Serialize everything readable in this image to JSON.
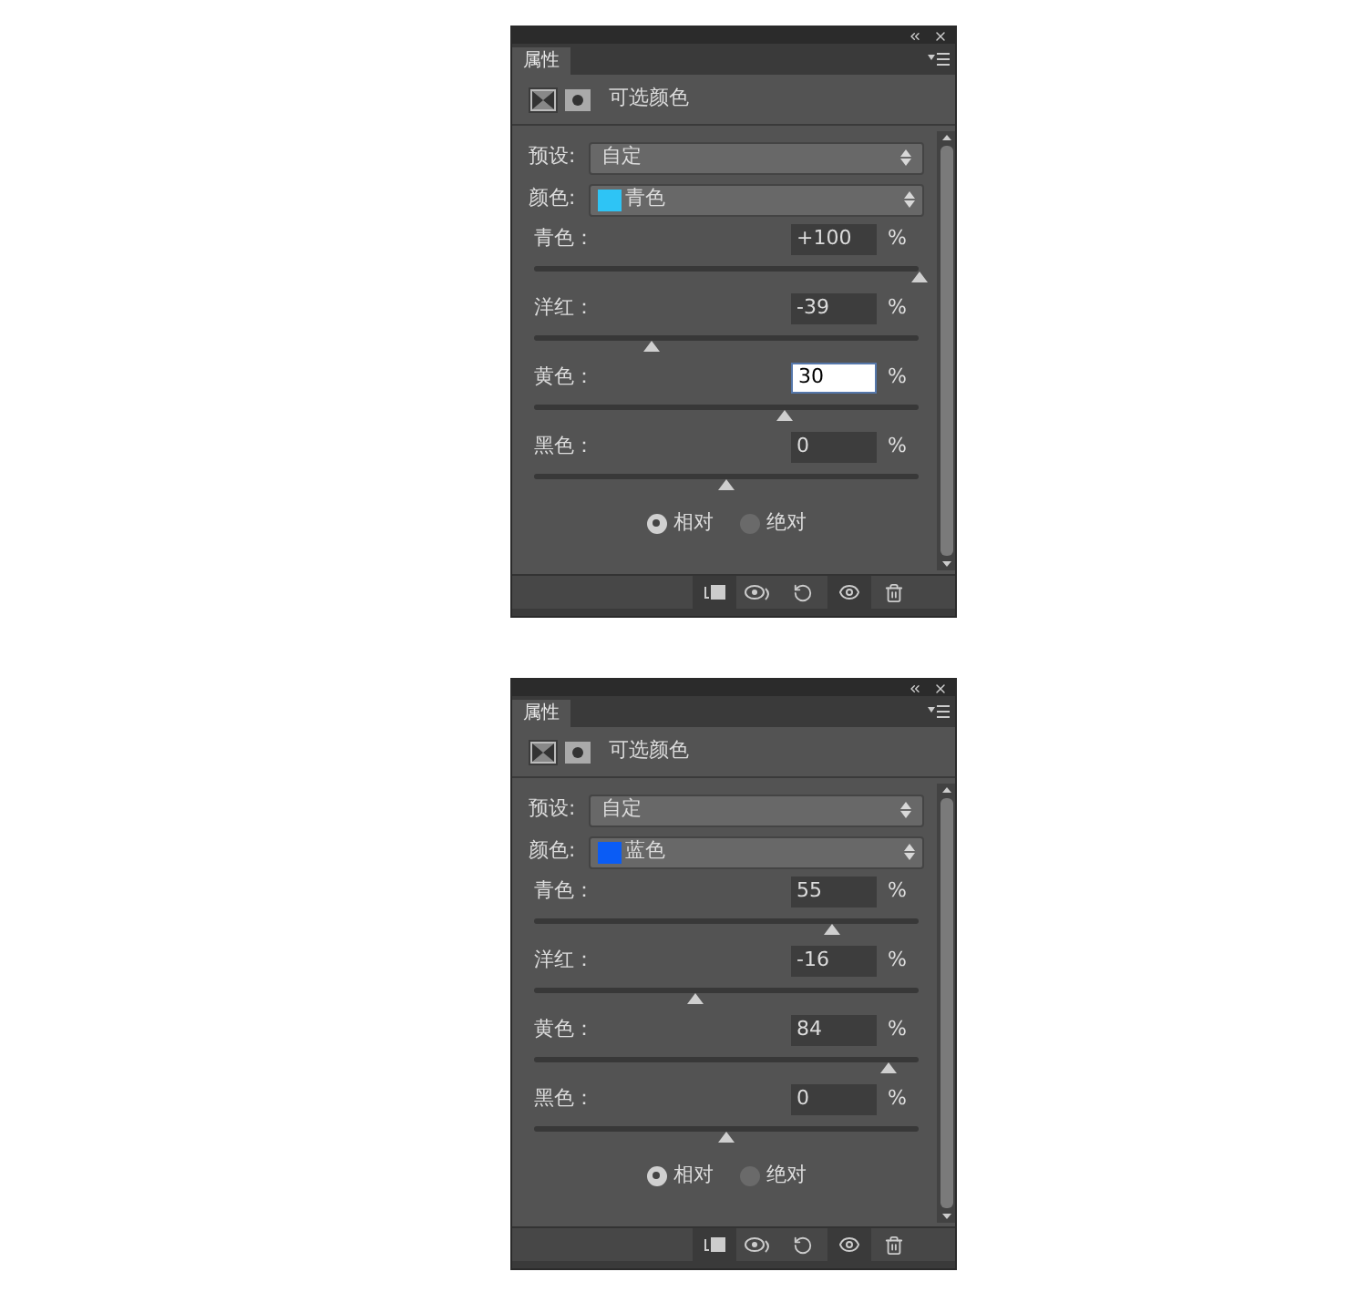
{
  "panels": [
    {
      "tab": "属性",
      "title": "可选颜色",
      "preset": {
        "label": "预设:",
        "value": "自定"
      },
      "color": {
        "label": "颜色:",
        "value": "青色",
        "color": "#2ec4f5"
      },
      "sliders": [
        {
          "label": "青色：",
          "value": "+100",
          "unit": "%",
          "level": 1,
          "focused": false
        },
        {
          "label": "洋红：",
          "value": "-39",
          "unit": "%",
          "level": 0.305,
          "focused": false
        },
        {
          "label": "黄色：",
          "value": "30",
          "unit": "%",
          "level": 0.65,
          "focused": true
        },
        {
          "label": "黑色：",
          "value": "0",
          "unit": "%",
          "level": 0.5,
          "focused": false
        }
      ],
      "modes": [
        {
          "label": "相对",
          "selected": true
        },
        {
          "label": "绝对",
          "selected": false
        }
      ]
    },
    {
      "tab": "属性",
      "title": "可选颜色",
      "preset": {
        "label": "预设:",
        "value": "自定"
      },
      "color": {
        "label": "颜色:",
        "value": "蓝色",
        "color": "#0a5cf5"
      },
      "sliders": [
        {
          "label": "青色：",
          "value": "55",
          "unit": "%",
          "level": 0.775,
          "focused": false
        },
        {
          "label": "洋红：",
          "value": "-16",
          "unit": "%",
          "level": 0.42,
          "focused": false
        },
        {
          "label": "黄色：",
          "value": "84",
          "unit": "%",
          "level": 0.92,
          "focused": false
        },
        {
          "label": "黑色：",
          "value": "0",
          "unit": "%",
          "level": 0.5,
          "focused": false
        }
      ],
      "modes": [
        {
          "label": "相对",
          "selected": true
        },
        {
          "label": "绝对",
          "selected": false
        }
      ]
    }
  ]
}
